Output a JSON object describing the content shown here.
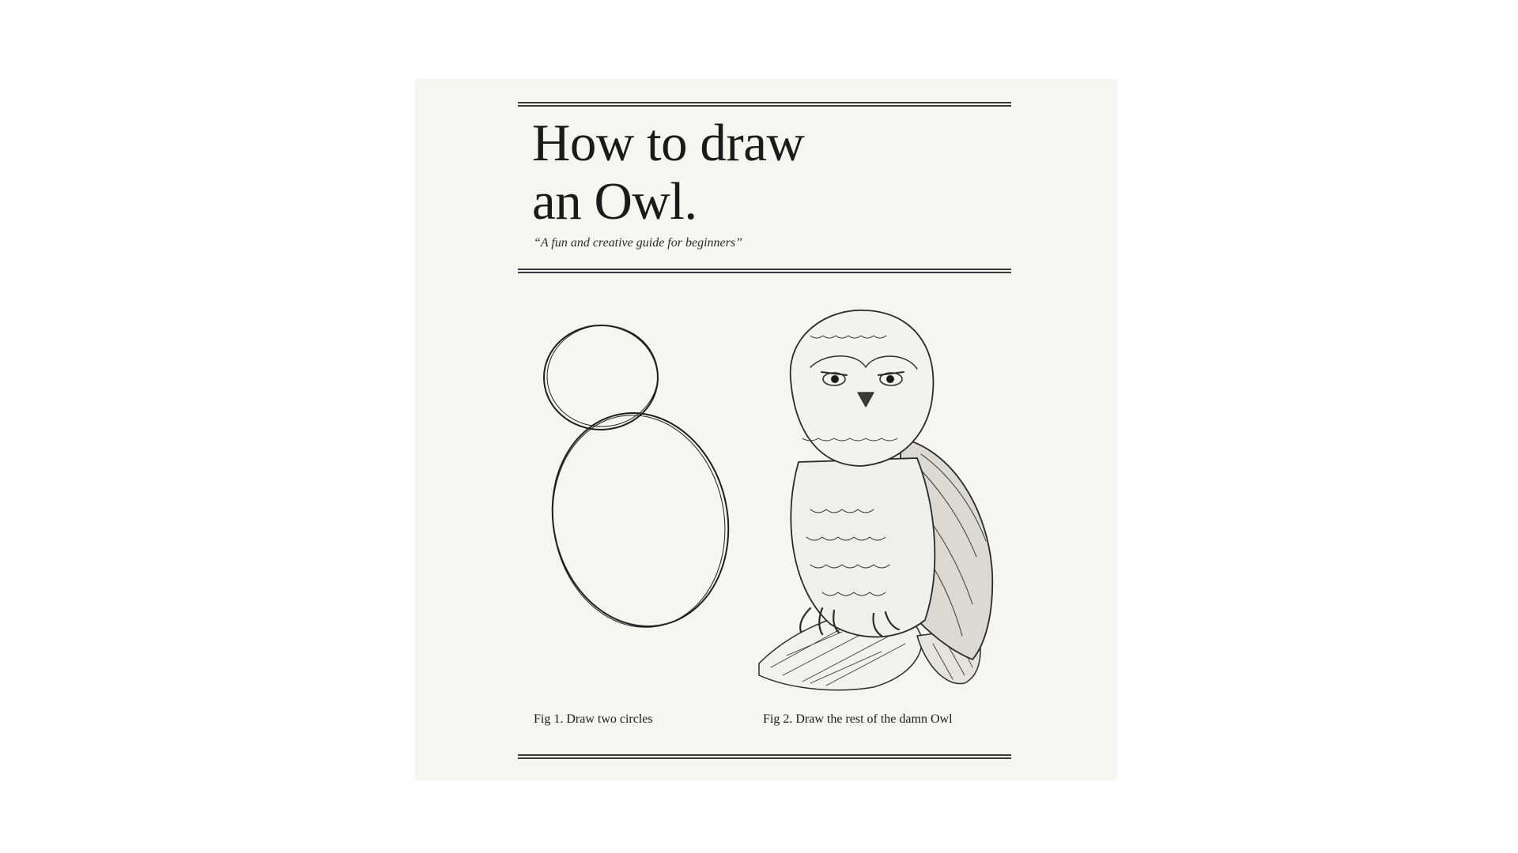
{
  "poster": {
    "title_line1": "How to draw",
    "title_line2": "an Owl.",
    "subtitle": "“A fun and creative guide for beginners”",
    "figures": [
      {
        "caption": "Fig 1. Draw two circles",
        "illustration": "two-circles-sketch"
      },
      {
        "caption": "Fig 2. Draw the rest of the damn Owl",
        "illustration": "detailed-owl-drawing"
      }
    ]
  },
  "colors": {
    "background": "#f7f5f0",
    "ink": "#1a1a1a",
    "page": "#ffffff"
  }
}
